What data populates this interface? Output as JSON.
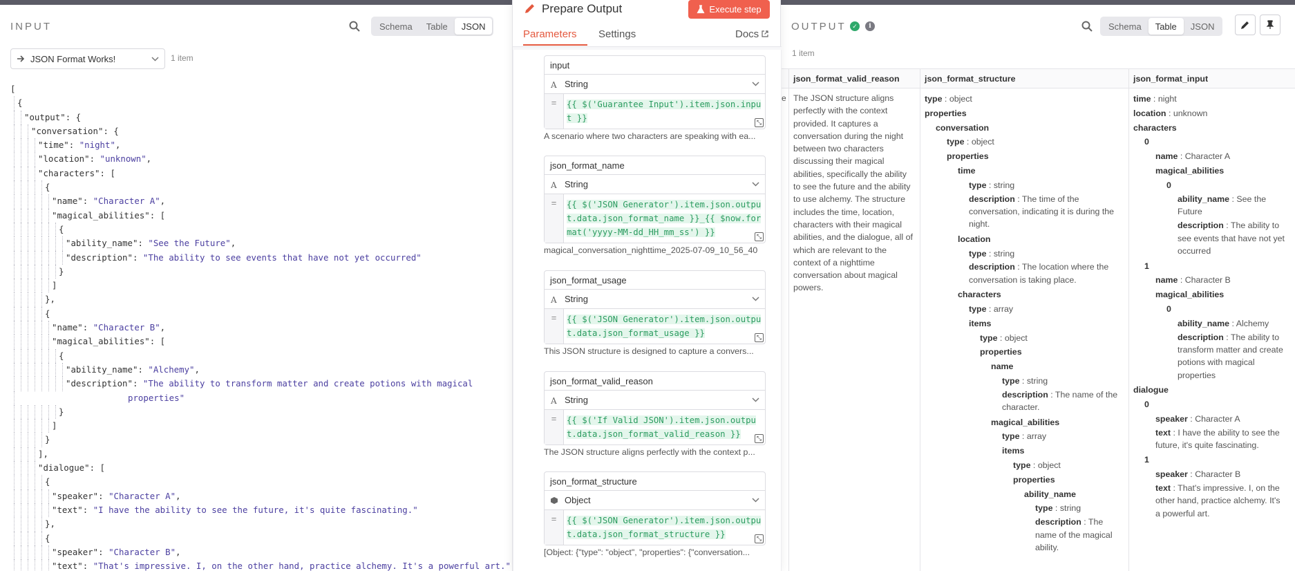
{
  "input": {
    "title": "INPUT",
    "views": [
      "Schema",
      "Table",
      "JSON"
    ],
    "selected_view": "JSON",
    "node_select": "JSON Format Works!",
    "item_count": "1 item",
    "json_lines": [
      {
        "indent": 0,
        "text": "["
      },
      {
        "indent": 1,
        "text": "{"
      },
      {
        "indent": 2,
        "key": "\"output\"",
        "rest": ": {"
      },
      {
        "indent": 3,
        "key": "\"conversation\"",
        "rest": ": {"
      },
      {
        "indent": 4,
        "key": "\"time\"",
        "sep": ": ",
        "val": "\"night\"",
        "tail": ","
      },
      {
        "indent": 4,
        "key": "\"location\"",
        "sep": ": ",
        "val": "\"unknown\"",
        "tail": ","
      },
      {
        "indent": 4,
        "key": "\"characters\"",
        "rest": ": ["
      },
      {
        "indent": 5,
        "text": "{"
      },
      {
        "indent": 6,
        "key": "\"name\"",
        "sep": ": ",
        "val": "\"Character A\"",
        "tail": ","
      },
      {
        "indent": 6,
        "key": "\"magical_abilities\"",
        "rest": ": ["
      },
      {
        "indent": 7,
        "text": "{"
      },
      {
        "indent": 8,
        "key": "\"ability_name\"",
        "sep": ": ",
        "val": "\"See the Future\"",
        "tail": ","
      },
      {
        "indent": 8,
        "key": "\"description\"",
        "sep": ": ",
        "val": "\"The ability to see events that have not yet occurred\"",
        "tail": ""
      },
      {
        "indent": 7,
        "text": "}"
      },
      {
        "indent": 6,
        "text": "]"
      },
      {
        "indent": 5,
        "text": "},"
      },
      {
        "indent": 5,
        "text": "{"
      },
      {
        "indent": 6,
        "key": "\"name\"",
        "sep": ": ",
        "val": "\"Character B\"",
        "tail": ","
      },
      {
        "indent": 6,
        "key": "\"magical_abilities\"",
        "rest": ": ["
      },
      {
        "indent": 7,
        "text": "{"
      },
      {
        "indent": 8,
        "key": "\"ability_name\"",
        "sep": ": ",
        "val": "\"Alchemy\"",
        "tail": ","
      },
      {
        "indent": 8,
        "key": "\"description\"",
        "sep": ": ",
        "val": "\"The ability to transform matter and create potions with magical",
        "tail": ""
      },
      {
        "indent": 17,
        "val": "properties\"",
        "tail": ""
      },
      {
        "indent": 7,
        "text": "}"
      },
      {
        "indent": 6,
        "text": "]"
      },
      {
        "indent": 5,
        "text": "}"
      },
      {
        "indent": 4,
        "text": "],"
      },
      {
        "indent": 4,
        "key": "\"dialogue\"",
        "rest": ": ["
      },
      {
        "indent": 5,
        "text": "{"
      },
      {
        "indent": 6,
        "key": "\"speaker\"",
        "sep": ": ",
        "val": "\"Character A\"",
        "tail": ","
      },
      {
        "indent": 6,
        "key": "\"text\"",
        "sep": ": ",
        "val": "\"I have the ability to see the future, it's quite fascinating.\"",
        "tail": ""
      },
      {
        "indent": 5,
        "text": "},"
      },
      {
        "indent": 5,
        "text": "{"
      },
      {
        "indent": 6,
        "key": "\"speaker\"",
        "sep": ": ",
        "val": "\"Character B\"",
        "tail": ","
      },
      {
        "indent": 6,
        "key": "\"text\"",
        "sep": ": ",
        "val": "\"That's impressive. I, on the other hand, practice alchemy. It's a powerful art.\"",
        "tail": ""
      }
    ]
  },
  "node": {
    "title": "Prepare Output",
    "execute_label": "Execute step",
    "tabs": [
      "Parameters",
      "Settings"
    ],
    "docs_label": "Docs",
    "fields": [
      {
        "name": "input",
        "type": "String",
        "expression": "{{ $('Guarantee Input').item.json.input }}",
        "hint": "A scenario where two characters are speaking with ea..."
      },
      {
        "name": "json_format_name",
        "type": "String",
        "expression": "{{ $('JSON Generator').item.json.output.data.json_format_name }}_{{ $now.format('yyyy-MM-dd_HH_mm_ss') }}",
        "hint": "magical_conversation_nighttime_2025-07-09_10_56_40"
      },
      {
        "name": "json_format_usage",
        "type": "String",
        "expression": "{{ $('JSON Generator').item.json.output.data.json_format_usage }}",
        "hint": "This JSON structure is designed to capture a convers..."
      },
      {
        "name": "json_format_valid_reason",
        "type": "String",
        "expression": "{{ $('If Valid JSON').item.json.output.data.json_format_valid_reason }}",
        "hint": "The JSON structure aligns perfectly with the context p..."
      },
      {
        "name": "json_format_structure",
        "type": "Object",
        "expression": "{{ $('JSON Generator').item.json.output.data.json_format_structure }}",
        "hint": "[Object: {\"type\": \"object\", \"properties\": {\"conversation..."
      }
    ]
  },
  "output": {
    "title": "OUTPUT",
    "views": [
      "Schema",
      "Table",
      "JSON"
    ],
    "selected_view": "Table",
    "item_count": "1 item",
    "columns": [
      "json_format_valid_reason",
      "json_format_structure",
      "json_format_input"
    ],
    "cut_col_char": "e",
    "valid_reason": "The JSON structure aligns perfectly with the context provided. It captures a conversation during the night between two characters discussing their magical abilities, specifically the ability to see the future and the ability to use alchemy. The structure includes the time, location, characters with their magical abilities, and the dialogue, all of which are relevant to the context of a nighttime conversation about magical powers.",
    "structure_tree": [
      {
        "d": 0,
        "k": "type",
        "v": "object"
      },
      {
        "d": 0,
        "k": "properties"
      },
      {
        "d": 1,
        "k": "conversation"
      },
      {
        "d": 2,
        "k": "type",
        "v": "object"
      },
      {
        "d": 2,
        "k": "properties"
      },
      {
        "d": 3,
        "k": "time"
      },
      {
        "d": 4,
        "k": "type",
        "v": "string"
      },
      {
        "d": 4,
        "k": "description",
        "v": "The time of the conversation, indicating it is during the night."
      },
      {
        "d": 3,
        "k": "location"
      },
      {
        "d": 4,
        "k": "type",
        "v": "string"
      },
      {
        "d": 4,
        "k": "description",
        "v": "The location where the conversation is taking place."
      },
      {
        "d": 3,
        "k": "characters"
      },
      {
        "d": 4,
        "k": "type",
        "v": "array"
      },
      {
        "d": 4,
        "k": "items"
      },
      {
        "d": 5,
        "k": "type",
        "v": "object"
      },
      {
        "d": 5,
        "k": "properties"
      },
      {
        "d": 6,
        "k": "name"
      },
      {
        "d": 7,
        "k": "type",
        "v": "string"
      },
      {
        "d": 7,
        "k": "description",
        "v": "The name of the character."
      },
      {
        "d": 6,
        "k": "magical_abilities"
      },
      {
        "d": 7,
        "k": "type",
        "v": "array"
      },
      {
        "d": 7,
        "k": "items"
      },
      {
        "d": 8,
        "k": "type",
        "v": "object"
      },
      {
        "d": 8,
        "k": "properties"
      },
      {
        "d": 9,
        "k": "ability_name"
      },
      {
        "d": 10,
        "k": "type",
        "v": "string"
      },
      {
        "d": 10,
        "k": "description",
        "v": "The name of the magical ability."
      }
    ],
    "input_tree": [
      {
        "d": 0,
        "k": "time",
        "v": "night"
      },
      {
        "d": 0,
        "k": "location",
        "v": "unknown"
      },
      {
        "d": 0,
        "k": "characters"
      },
      {
        "d": 1,
        "k": "0"
      },
      {
        "d": 2,
        "k": "name",
        "v": "Character A"
      },
      {
        "d": 2,
        "k": "magical_abilities"
      },
      {
        "d": 3,
        "k": "0"
      },
      {
        "d": 4,
        "k": "ability_name",
        "v": "See the Future"
      },
      {
        "d": 4,
        "k": "description",
        "v": "The ability to see events that have not yet occurred"
      },
      {
        "d": 1,
        "k": "1"
      },
      {
        "d": 2,
        "k": "name",
        "v": "Character B"
      },
      {
        "d": 2,
        "k": "magical_abilities"
      },
      {
        "d": 3,
        "k": "0"
      },
      {
        "d": 4,
        "k": "ability_name",
        "v": "Alchemy"
      },
      {
        "d": 4,
        "k": "description",
        "v": "The ability to transform matter and create potions with magical properties"
      },
      {
        "d": 0,
        "k": "dialogue"
      },
      {
        "d": 1,
        "k": "0"
      },
      {
        "d": 2,
        "k": "speaker",
        "v": "Character A"
      },
      {
        "d": 2,
        "k": "text",
        "v": "I have the ability to see the future, it's quite fascinating."
      },
      {
        "d": 1,
        "k": "1"
      },
      {
        "d": 2,
        "k": "speaker",
        "v": "Character B"
      },
      {
        "d": 2,
        "k": "text",
        "v": "That's impressive. I, on the other hand, practice alchemy. It's a powerful art."
      }
    ]
  },
  "colors": {
    "accent": "#e4593f",
    "execute": "#f0604e",
    "success": "#2fa96b",
    "string": "#4b3fa0",
    "expr": "#2c9c60"
  },
  "icons": [
    "search-icon",
    "arrow-right-icon",
    "chevron-down-icon",
    "pencil-icon",
    "flask-icon",
    "external-link-icon",
    "check-icon",
    "info-icon",
    "edit-icon",
    "pin-icon",
    "text-type-icon",
    "object-type-icon",
    "expand-icon"
  ]
}
